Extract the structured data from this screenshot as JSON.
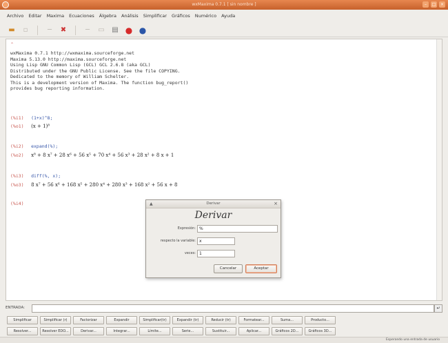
{
  "window": {
    "title": "wxMaxima 0.7.1 [ sin nombre ]"
  },
  "menu": [
    "Archivo",
    "Editar",
    "Maxima",
    "Ecuaciones",
    "Álgebra",
    "Análisis",
    "Simplificar",
    "Gráficos",
    "Numérico",
    "Ayuda"
  ],
  "toolbar": [
    {
      "icon": "open-icon",
      "glyph": "📂",
      "enabled": true
    },
    {
      "icon": "save-icon",
      "glyph": "▫",
      "enabled": false
    },
    {
      "icon": "cut-icon",
      "glyph": "─",
      "enabled": false
    },
    {
      "icon": "delete-icon",
      "glyph": "✖",
      "enabled": true
    },
    {
      "icon": "copy-icon",
      "glyph": "─",
      "enabled": false
    },
    {
      "icon": "paste-icon",
      "glyph": "▭",
      "enabled": false
    },
    {
      "icon": "print-icon",
      "glyph": "▤",
      "enabled": true
    },
    {
      "icon": "stop-icon",
      "glyph": "●",
      "enabled": true,
      "color": "#d62b2b"
    },
    {
      "icon": "help-icon",
      "glyph": "●",
      "enabled": true,
      "color": "#2b56a8"
    }
  ],
  "worksheet": {
    "banner": [
      "wxMaxima 0.7.1 http://wxmaxima.sourceforge.net",
      "Maxima 5.13.0 http://maxima.sourceforge.net",
      "Using Lisp GNU Common Lisp (GCL) GCL 2.6.8 (aka GCL)",
      "Distributed under the GNU Public License. See the file COPYING.",
      "Dedicated to the memory of William Schelter.",
      "This is a development version of Maxima. The function bug_report()",
      "provides bug reporting information."
    ],
    "cells": [
      {
        "in_label": "(%i1)",
        "input": "(1+x)^8;",
        "out_label": "(%o1)",
        "output": "(x + 1)⁸"
      },
      {
        "in_label": "(%i2)",
        "input": "expand(%);",
        "out_label": "(%o2)",
        "output": "x⁸ + 8 x⁷ + 28 x⁶ + 56 x⁵ + 70 x⁴ + 56 x³ + 28 x² + 8 x + 1"
      },
      {
        "in_label": "(%i3)",
        "input": "diff(%, x);",
        "out_label": "(%o3)",
        "output": "8 x⁷ + 56 x⁶ + 168 x⁵ + 280 x⁴ + 280 x³ + 168 x² + 56 x + 8"
      }
    ],
    "pending_label": "(%i4)"
  },
  "dialog": {
    "title": "Derivar",
    "heading": "Derivar",
    "fields": [
      {
        "label": "Expresión:",
        "value": "%"
      },
      {
        "label": "respecto la variable:",
        "value": "x"
      },
      {
        "label": "veces:",
        "value": "1"
      }
    ],
    "cancel_label": "Cancelar",
    "ok_label": "Aceptar"
  },
  "entry": {
    "label": "ENTRADA:",
    "go_label": "↵"
  },
  "buttons_row1": [
    "Simplificar",
    "Simplificar (r)",
    "Factorizar",
    "Expandir",
    "Simplificar(tr)",
    "Expandir (tr)",
    "Reducir (tr)",
    "Formatear...",
    "Suma...",
    "Producto..."
  ],
  "buttons_row2": [
    "Resolver...",
    "Resolver EDO...",
    "Derivar...",
    "Integrar...",
    "Límite...",
    "Serie...",
    "Sustituir...",
    "Aplicar...",
    "Gráficos 2D...",
    "Gráficos 3D..."
  ],
  "status": {
    "text": "Esperando una entrada de usuario"
  }
}
